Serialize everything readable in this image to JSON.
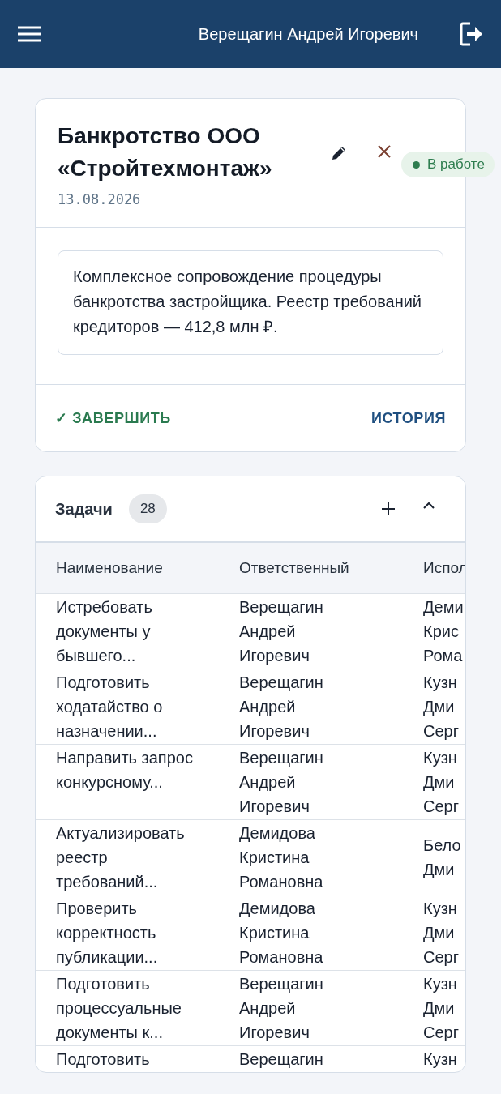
{
  "header": {
    "user_name": "Верещагин Андрей Игоревич"
  },
  "case": {
    "title": "Банкротство ООО «Стройтехмонтаж»",
    "date": "13.08.2026",
    "status": {
      "label": "В работе",
      "color": "#2e7d4f"
    },
    "description": "Комплексное сопровождение процедуры банкротства застройщика. Реестр требований кредиторов — 412,8 млн ₽.",
    "actions": [
      {
        "label": "✓ ЗАВЕРШИТЬ",
        "kind": "confirm"
      },
      {
        "label": "ИСТОРИЯ",
        "kind": "link"
      }
    ]
  },
  "tasks": {
    "title": "Задачи",
    "count": "28",
    "expanded": true,
    "table": {
      "columns": [
        "Наименование",
        "Ответственный",
        "Испол"
      ],
      "rows": [
        [
          "Истребовать документы у бывшего...",
          "Верещагин Андрей Игоревич",
          "Деми Крис Рома"
        ],
        [
          "Подготовить ходатайство о назначении...",
          "Верещагин Андрей Игоревич",
          "Кузн Дми Серг"
        ],
        [
          "Направить запрос конкурсному...",
          "Верещагин Андрей Игоревич",
          "Кузн Дми Серг"
        ],
        [
          "Актуализировать реестр требований...",
          "Демидова Кристина Романовна",
          "Бело Дми"
        ],
        [
          "Проверить корректность публикации...",
          "Демидова Кристина Романовна",
          "Кузн Дми Серг"
        ],
        [
          "Подготовить процессуальные документы к...",
          "Верещагин Андрей Игоревич",
          "Кузн Дми Серг"
        ],
        [
          "Подготовить",
          "Верещагин",
          "Кузн"
        ]
      ]
    }
  }
}
